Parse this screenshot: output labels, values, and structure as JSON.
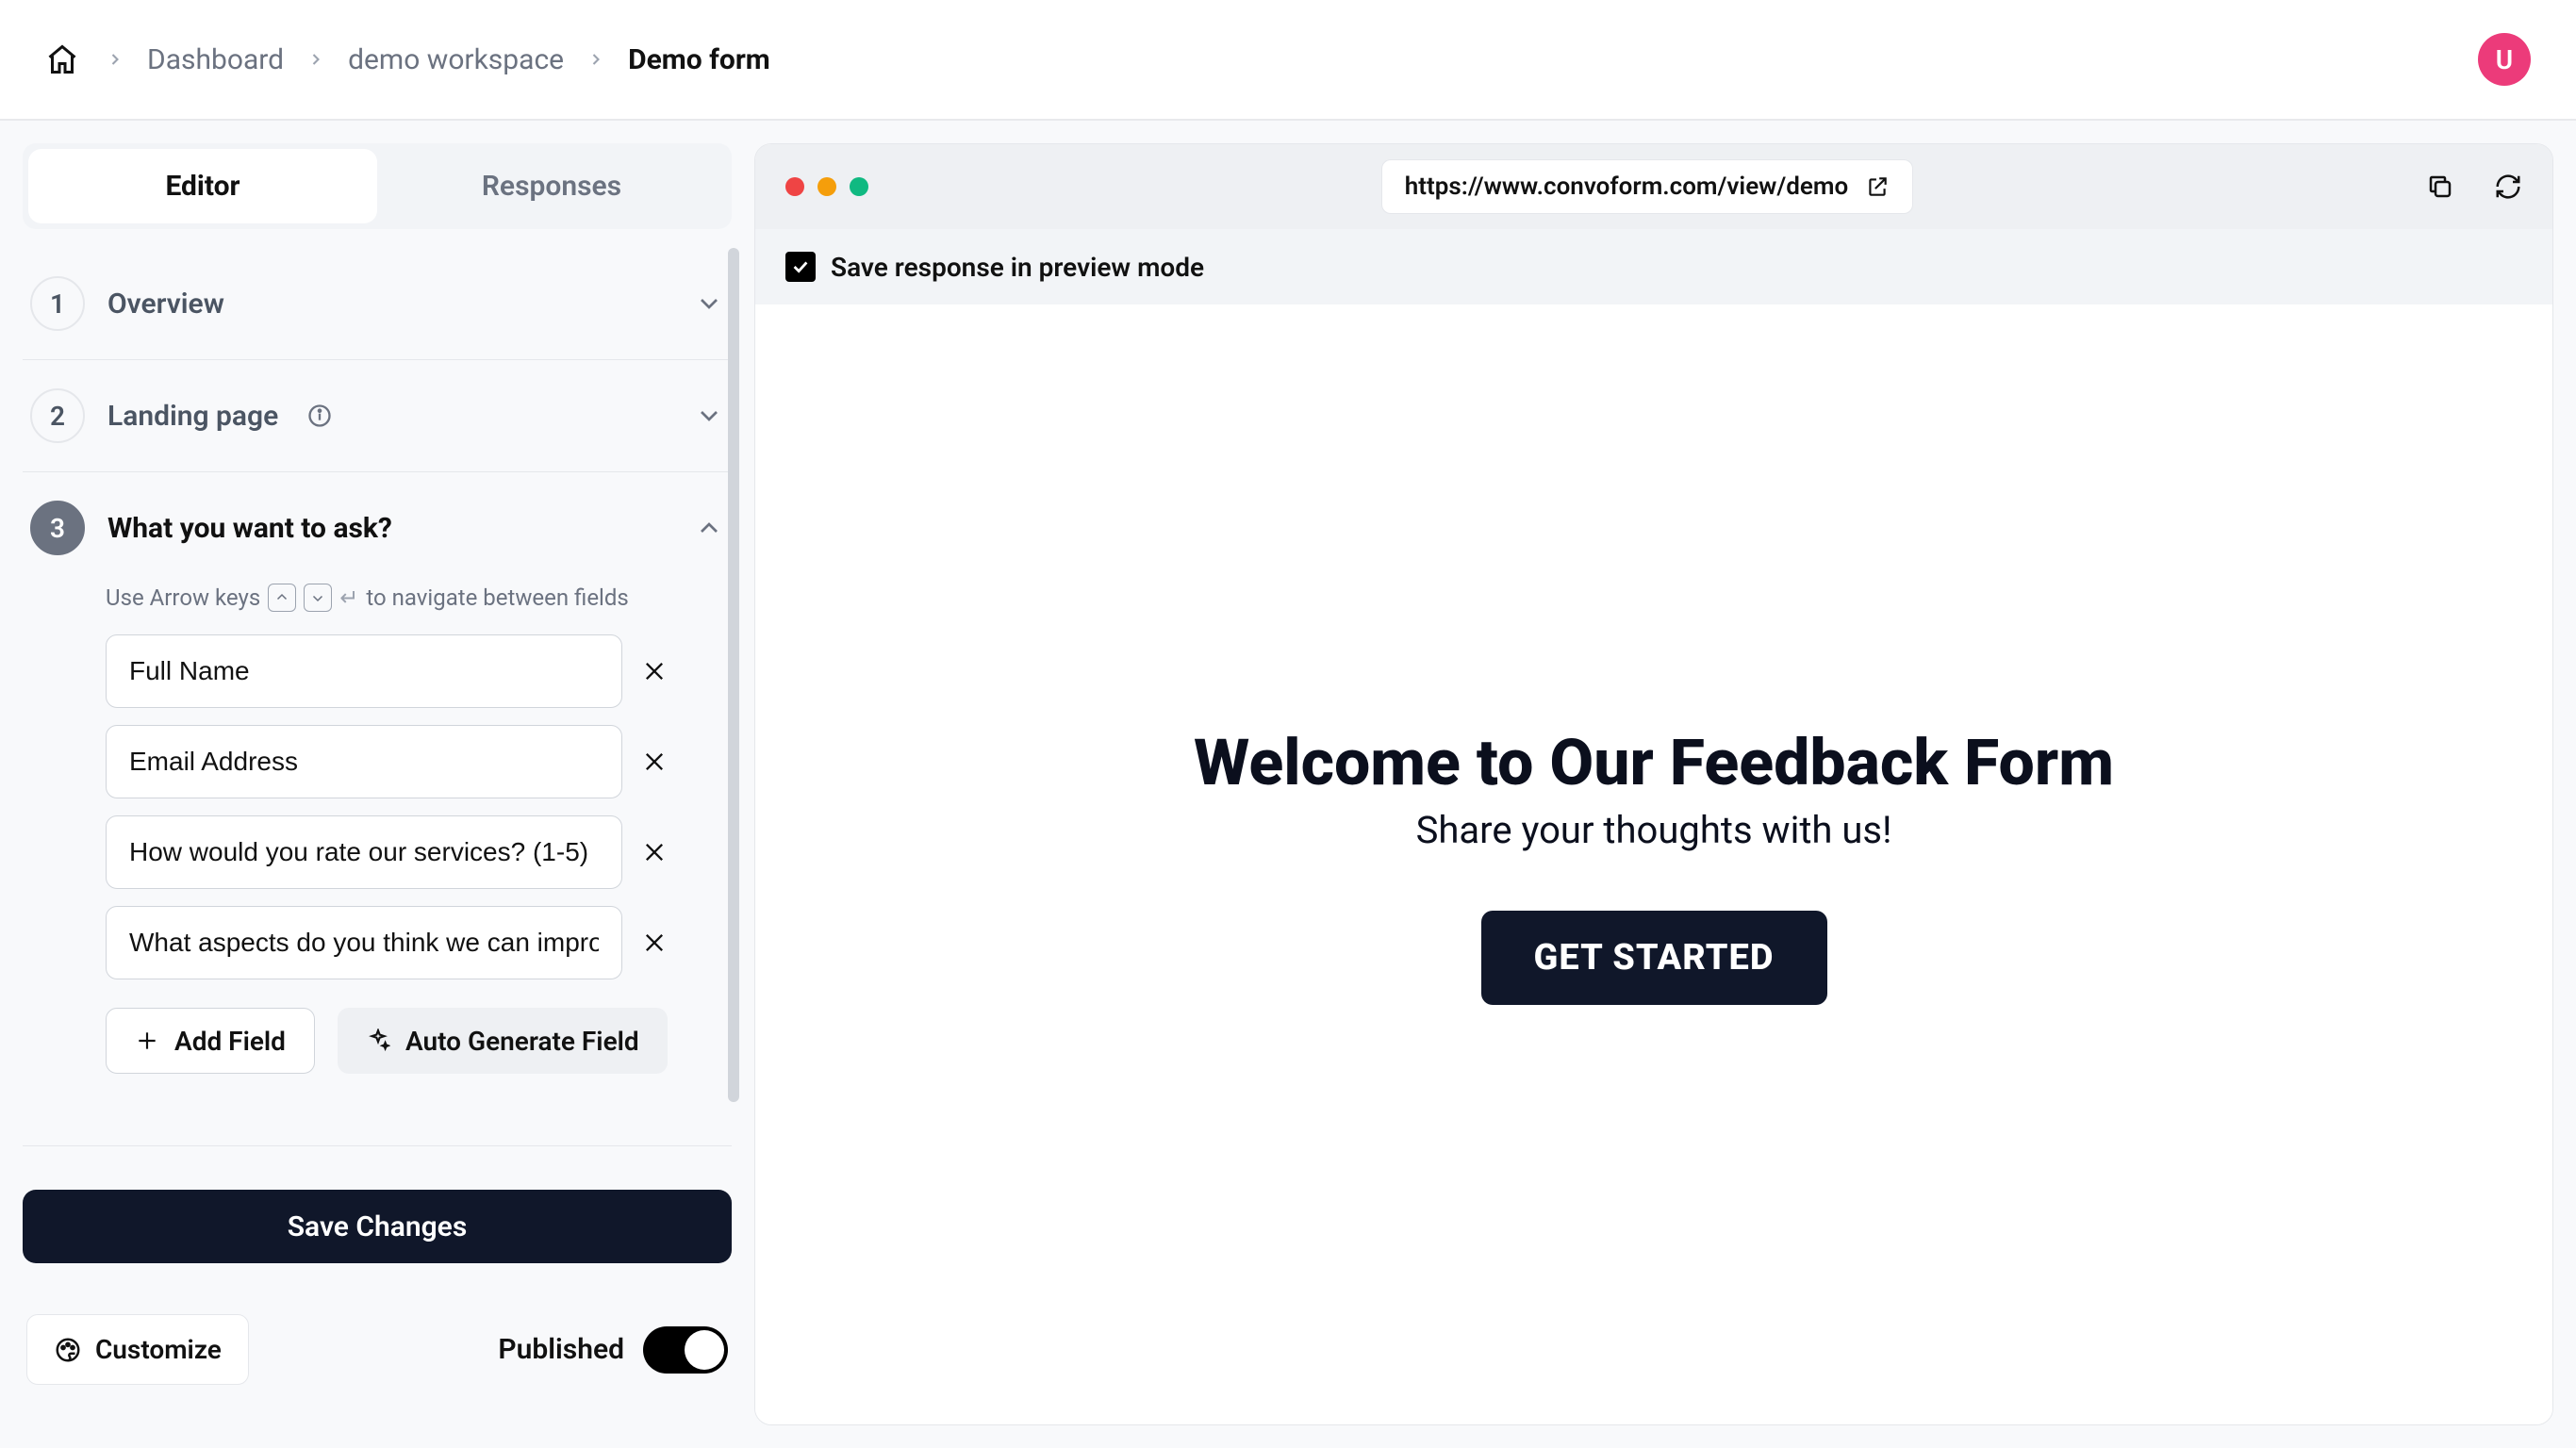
{
  "header": {
    "breadcrumb": [
      "Dashboard",
      "demo workspace",
      "Demo form"
    ],
    "avatar_letter": "U"
  },
  "tabs": {
    "editor": "Editor",
    "responses": "Responses"
  },
  "steps": {
    "overview": {
      "num": "1",
      "title": "Overview"
    },
    "landing": {
      "num": "2",
      "title": "Landing page"
    },
    "ask": {
      "num": "3",
      "title": "What you want to ask?"
    }
  },
  "hint": {
    "prefix": "Use Arrow keys",
    "suffix": "to navigate between fields"
  },
  "fields": [
    "Full Name",
    "Email Address",
    "How would you rate our services? (1-5)",
    "What aspects do you think we can improve?"
  ],
  "buttons": {
    "add_field": "Add Field",
    "auto_generate": "Auto Generate Field",
    "save_changes": "Save Changes",
    "customize": "Customize"
  },
  "publish": {
    "label": "Published"
  },
  "preview": {
    "url": "https://www.convoform.com/view/demo",
    "save_response": "Save response in preview mode",
    "title": "Welcome to Our Feedback Form",
    "subtitle": "Share your thoughts with us!",
    "cta": "GET STARTED"
  }
}
